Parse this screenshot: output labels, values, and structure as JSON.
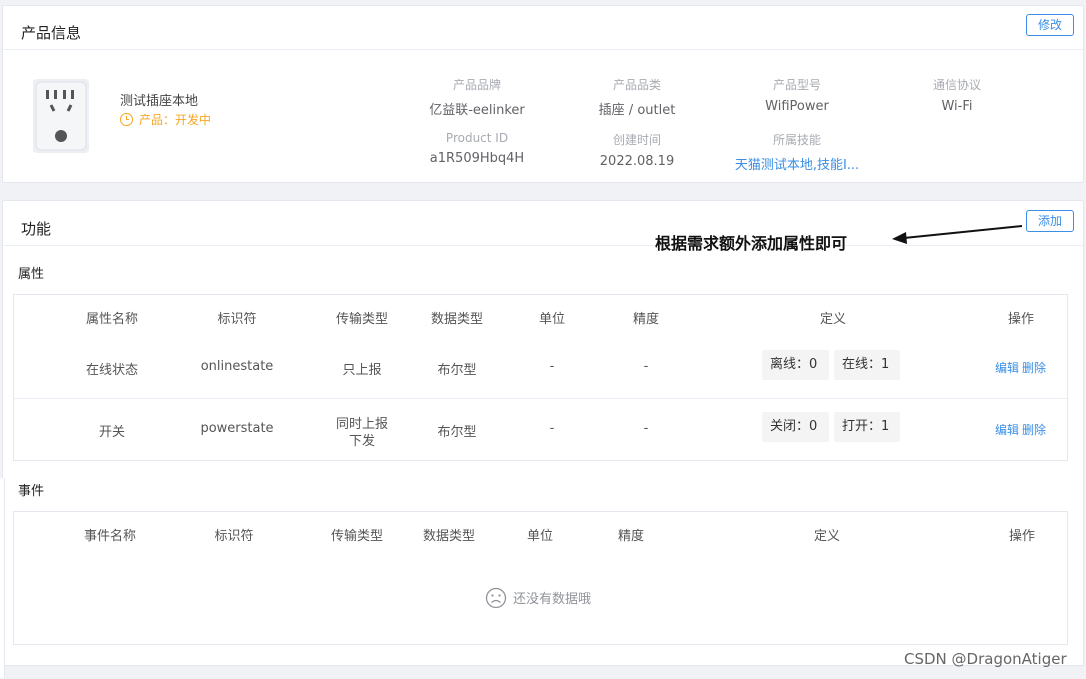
{
  "product_card": {
    "title": "产品信息",
    "edit_button": "修改",
    "product_name": "测试插座本地",
    "status": "产品：开发中",
    "meta": [
      {
        "label": "产品品牌",
        "value": "亿益联-eelinker"
      },
      {
        "label": "产品品类",
        "value": "插座 / outlet"
      },
      {
        "label": "产品型号",
        "value": "WifiPower"
      },
      {
        "label": "通信协议",
        "value": "Wi-Fi"
      },
      {
        "label": "Product ID",
        "value": "a1R509Hbq4H"
      },
      {
        "label": "创建时间",
        "value": "2022.08.19"
      },
      {
        "label": "所属技能",
        "value": "天猫测试本地,技能I..."
      }
    ]
  },
  "function_card": {
    "title": "功能",
    "add_button": "添加",
    "annotation": "根据需求额外添加属性即可",
    "properties": {
      "title": "属性",
      "headers": [
        "属性名称",
        "标识符",
        "传输类型",
        "数据类型",
        "单位",
        "精度",
        "定义",
        "操作"
      ],
      "rows": [
        {
          "name": "在线状态",
          "id": "onlinestate",
          "transfer": "只上报",
          "transfer2": "",
          "dtype": "布尔型",
          "unit": "-",
          "precision": "-",
          "def": [
            "离线：0",
            "在线：1"
          ],
          "edit": "编辑",
          "delete": "删除"
        },
        {
          "name": "开关",
          "id": "powerstate",
          "transfer": "同时上报",
          "transfer2": "下发",
          "dtype": "布尔型",
          "unit": "-",
          "precision": "-",
          "def": [
            "关闭：0",
            "打开：1"
          ],
          "edit": "编辑",
          "delete": "删除"
        }
      ]
    },
    "events": {
      "title": "事件",
      "headers": [
        "事件名称",
        "标识符",
        "传输类型",
        "数据类型",
        "单位",
        "精度",
        "定义",
        "操作"
      ],
      "empty_text": "还没有数据哦"
    }
  },
  "watermark": "CSDN @DragonAtiger"
}
